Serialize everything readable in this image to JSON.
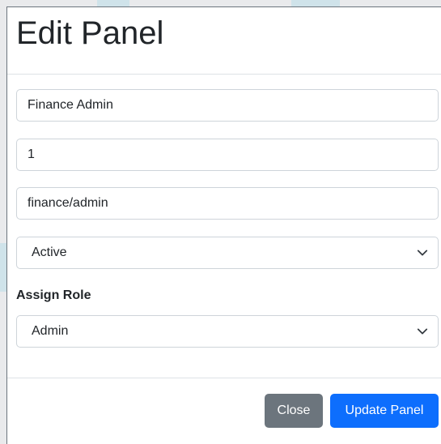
{
  "modal": {
    "title": "Edit Panel",
    "fields": {
      "panel_name": "Finance Admin",
      "order": "1",
      "path": "finance/admin",
      "status": "Active"
    },
    "assign_role_label": "Assign Role",
    "assign_role_value": "Admin",
    "buttons": {
      "close": "Close",
      "update": "Update Panel"
    }
  },
  "colors": {
    "primary": "#0d6efd",
    "secondary": "#6c757d"
  }
}
